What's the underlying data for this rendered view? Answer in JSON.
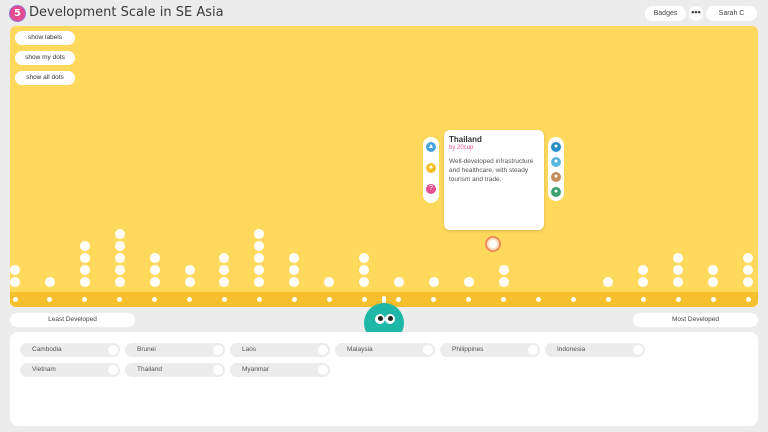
{
  "app": {
    "logo_text": "5",
    "title": "Development Scale in SE Asia"
  },
  "header": {
    "badges_label": "Badges",
    "more_label": "•••",
    "user_label": "Sarah C"
  },
  "controls": {
    "show_labels": "show labels",
    "show_my_dots": "show my dots",
    "show_all_dots": "show all dots"
  },
  "card": {
    "title": "Thailand",
    "author": "by 20cup",
    "body": "Well-developed infrastructure and healthcare, with steady tourism and trade."
  },
  "scale": {
    "left_label": "Least Developed",
    "right_label": "Most Developed",
    "columns": 21,
    "column_counts": [
      2,
      1,
      4,
      5,
      3,
      2,
      3,
      5,
      3,
      1,
      3,
      1,
      1,
      1,
      2,
      0,
      0,
      1,
      2,
      3,
      2,
      3
    ]
  },
  "countries": [
    {
      "label": "Cambodia"
    },
    {
      "label": "Brunei"
    },
    {
      "label": "Laos"
    },
    {
      "label": "Malaysia"
    },
    {
      "label": "Philippines"
    },
    {
      "label": "Indonesia"
    },
    {
      "label": "Vietnam"
    },
    {
      "label": "Thailand"
    },
    {
      "label": "Myanmar"
    }
  ],
  "colors": {
    "board": "#ffd95c",
    "track": "#f6c02c",
    "mascot": "#1fb7a8",
    "accent": "#e4508d"
  }
}
